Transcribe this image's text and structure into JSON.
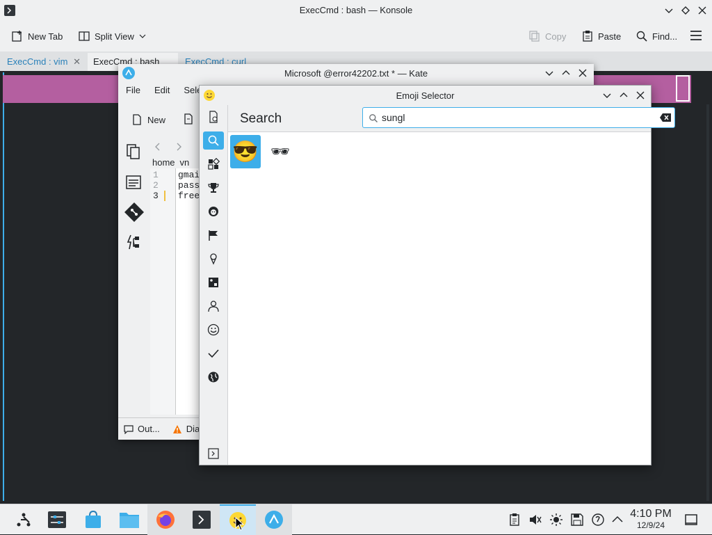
{
  "konsole": {
    "title": "ExecCmd : bash — Konsole",
    "toolbar": {
      "new_tab": "New Tab",
      "split_view": "Split View",
      "copy": "Copy",
      "paste": "Paste",
      "find": "Find..."
    },
    "tabs": [
      {
        "label": "ExecCmd : vim"
      },
      {
        "label": "ExecCmd : bash"
      },
      {
        "label": "ExecCmd : curl"
      }
    ]
  },
  "kate": {
    "title": "Microsoft @error42202.txt * — Kate",
    "menu": [
      "File",
      "Edit",
      "Sele"
    ],
    "toolbar_new": "New",
    "breadcrumb": [
      "home",
      "vn"
    ],
    "lines": [
      {
        "num": "1",
        "text": "gmai"
      },
      {
        "num": "2",
        "text": "pass"
      },
      {
        "num": "3",
        "text": "free"
      }
    ],
    "footer": {
      "output": "Out...",
      "diagnostics": "Dia"
    }
  },
  "emoji_selector": {
    "title": "Emoji Selector",
    "heading": "Search",
    "search_value": "sungl",
    "results": [
      "😎",
      "🕶"
    ]
  },
  "taskbar": {
    "time": "4:10 PM",
    "date": "12/9/24"
  },
  "colors": {
    "accent": "#3daee9",
    "terminal_bg": "#232629",
    "highlight_bar": "#b45fa0",
    "window_bg": "#eff0f1"
  }
}
